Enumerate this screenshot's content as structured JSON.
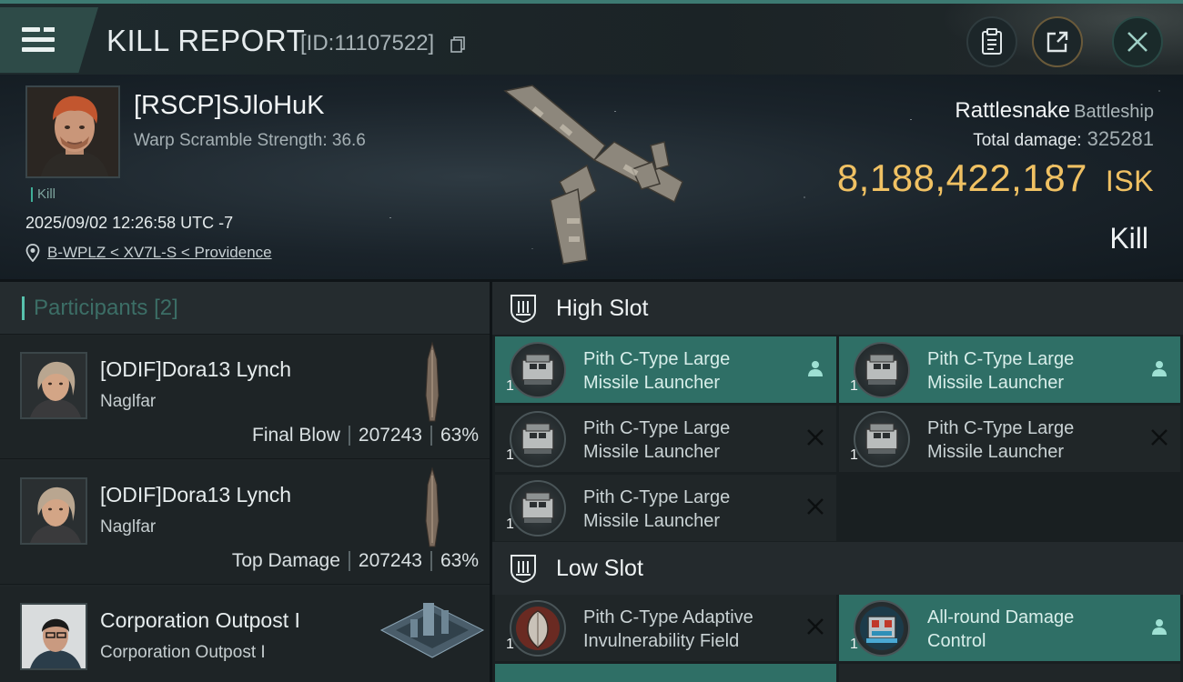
{
  "header": {
    "title": "KILL REPORT",
    "id_label": "[ID:11107522]"
  },
  "victim": {
    "name": "[RSCP]SJloHuK",
    "warp_scramble": "Warp Scramble Strength: 36.6",
    "kill_tag": "Kill",
    "timestamp": "2025/09/02 12:26:58 UTC -7",
    "location": "B-WPLZ < XV7L-S < Providence",
    "ship_name": "Rattlesnake",
    "ship_class": "Battleship",
    "total_damage_label": "Total damage:",
    "total_damage": "325281",
    "isk_value": "8,188,422,187",
    "isk_unit": "ISK",
    "result": "Kill"
  },
  "participants": {
    "title": "Participants",
    "count": "[2]",
    "rows": [
      {
        "name": "[ODIF]Dora13 Lynch",
        "ship": "Naglfar",
        "role": "Final Blow",
        "damage": "207243",
        "percent": "63%"
      },
      {
        "name": "[ODIF]Dora13 Lynch",
        "ship": "Naglfar",
        "role": "Top Damage",
        "damage": "207243",
        "percent": "63%"
      },
      {
        "name": "Corporation Outpost I",
        "ship": "Corporation Outpost I"
      }
    ]
  },
  "modules": {
    "high_slot_title": "High Slot",
    "low_slot_title": "Low Slot",
    "high": [
      {
        "name_line1": "Pith C-Type Large",
        "name_line2": "Missile Launcher",
        "qty": "1",
        "status": "dropped"
      },
      {
        "name_line1": "Pith C-Type Large",
        "name_line2": "Missile Launcher",
        "qty": "1",
        "status": "dropped"
      },
      {
        "name_line1": "Pith C-Type Large",
        "name_line2": "Missile Launcher",
        "qty": "1",
        "status": "destroyed"
      },
      {
        "name_line1": "Pith C-Type Large",
        "name_line2": "Missile Launcher",
        "qty": "1",
        "status": "destroyed"
      },
      {
        "name_line1": "Pith C-Type Large",
        "name_line2": "Missile Launcher",
        "qty": "1",
        "status": "destroyed"
      }
    ],
    "low": [
      {
        "name_line1": "Pith C-Type Adaptive",
        "name_line2": "Invulnerability Field",
        "qty": "1",
        "status": "destroyed"
      },
      {
        "name_line1": "All-round Damage",
        "name_line2": "Control",
        "qty": "1",
        "status": "dropped"
      }
    ]
  },
  "icons": {
    "menu": "hamburger-menu-icon",
    "copy": "copy-icon",
    "clipboard": "clipboard-icon",
    "share": "share-icon",
    "close": "close-icon",
    "location": "location-pin-icon",
    "dropped": "person-icon",
    "destroyed": "x-icon"
  },
  "colors": {
    "accent": "#57c2ad",
    "isk": "#f0c163",
    "dropped_bg": "#2f6f66"
  }
}
